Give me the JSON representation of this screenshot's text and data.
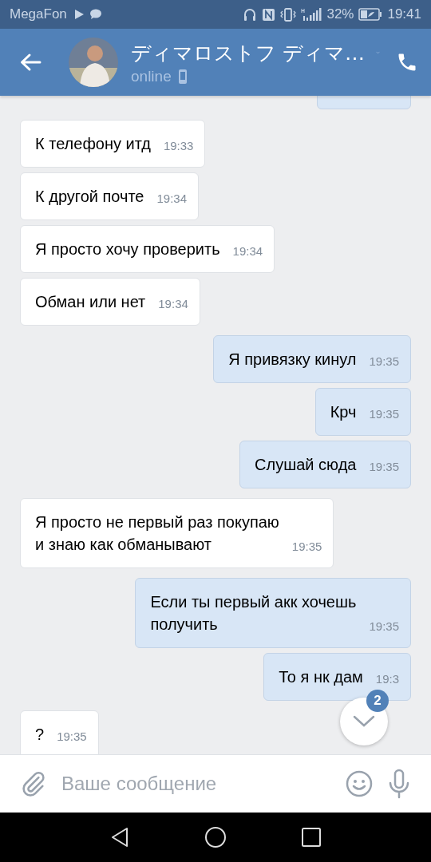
{
  "status_bar": {
    "carrier": "MegaFon",
    "battery": "32%",
    "time": "19:41"
  },
  "header": {
    "name": "ディマロストフ ディマ…",
    "status": "online"
  },
  "messages": [
    {
      "kind": "incoming",
      "text": "К телефону итд",
      "time": "19:33"
    },
    {
      "kind": "incoming",
      "text": "К другой почте",
      "time": "19:34"
    },
    {
      "kind": "incoming",
      "text": "Я просто хочу проверить",
      "time": "19:34"
    },
    {
      "kind": "incoming",
      "text": "Обман или нет",
      "time": "19:34"
    },
    {
      "kind": "outgoing",
      "text": "Я привязку кинул",
      "time": "19:35"
    },
    {
      "kind": "outgoing",
      "text": "Крч",
      "time": "19:35"
    },
    {
      "kind": "outgoing",
      "text": "Слушай сюда",
      "time": "19:35"
    },
    {
      "kind": "incoming",
      "text": "Я просто не первый раз покупаю\nи знаю как обманывают",
      "time": "19:35"
    },
    {
      "kind": "outgoing",
      "text": "Если ты первый акк хочешь\nполучить",
      "time": "19:35"
    },
    {
      "kind": "outgoing",
      "text": "То я нк дам",
      "time": "19:3"
    },
    {
      "kind": "incoming",
      "text": "?",
      "time": "19:35"
    }
  ],
  "scroll_button": {
    "badge": "2"
  },
  "composer": {
    "placeholder": "Ваше сообщение"
  }
}
